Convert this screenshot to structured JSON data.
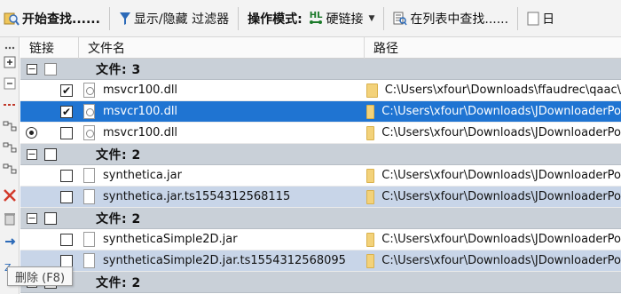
{
  "toolbar": {
    "start_search": "开始查找......",
    "filter_toggle": "显示/隐藏 过滤器",
    "mode_label": "操作模式:",
    "mode_badge": "HL",
    "mode_value": "硬链接",
    "find_in_list": "在列表中查找......",
    "cut_item": "日"
  },
  "grid": {
    "columns": {
      "link": "链接",
      "name": "文件名",
      "path": "路径"
    },
    "groups": [
      {
        "title": "文件: 3"
      },
      {
        "title": "文件: 2"
      },
      {
        "title": "文件: 2"
      },
      {
        "title": "文件: 2"
      }
    ],
    "rows": [
      {
        "name": "msvcr100.dll",
        "path": "C:\\Users\\xfour\\Downloads\\ffaudrec\\qaac\\"
      },
      {
        "name": "msvcr100.dll",
        "path": "C:\\Users\\xfour\\Downloads\\JDownloaderPo"
      },
      {
        "name": "msvcr100.dll",
        "path": "C:\\Users\\xfour\\Downloads\\JDownloaderPo"
      },
      {
        "name": "synthetica.jar",
        "path": "C:\\Users\\xfour\\Downloads\\JDownloaderPo"
      },
      {
        "name": "synthetica.jar.ts1554312568115",
        "path": "C:\\Users\\xfour\\Downloads\\JDownloaderPo"
      },
      {
        "name": "syntheticaSimple2D.jar",
        "path": "C:\\Users\\xfour\\Downloads\\JDownloaderPo"
      },
      {
        "name": "syntheticaSimple2D.jar.ts1554312568095",
        "path": "C:\\Users\\xfour\\Downloads\\JDownloaderPo"
      }
    ]
  },
  "tooltip": {
    "text": "删除 (F8)"
  },
  "colors": {
    "selection": "#1f74d2",
    "group_row": "#c9d0d8",
    "alt_row": "#c8d5e8",
    "folder": "#f3d27a"
  },
  "icons": [
    "search-icon",
    "filter-icon",
    "hardlink-icon",
    "dropdown-icon",
    "find-list-icon",
    "file-icon",
    "folder-icon",
    "delete-icon"
  ]
}
